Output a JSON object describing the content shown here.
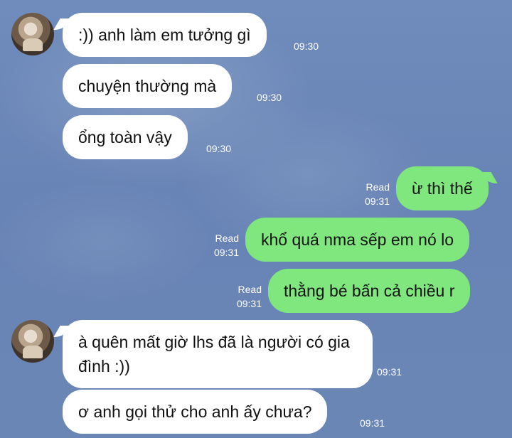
{
  "messages": [
    {
      "direction": "incoming",
      "text": ":)) anh làm em tưởng gì",
      "time": "09:30"
    },
    {
      "direction": "incoming",
      "text": "chuyện thường mà",
      "time": "09:30"
    },
    {
      "direction": "incoming",
      "text": "ổng toàn vậy",
      "time": "09:30"
    },
    {
      "direction": "outgoing",
      "text": "ừ thì thế",
      "status": "Read",
      "time": "09:31"
    },
    {
      "direction": "outgoing",
      "text": "khổ quá nma sếp em nó lo",
      "status": "Read",
      "time": "09:31"
    },
    {
      "direction": "outgoing",
      "text": "thằng bé bấn cả chiều r",
      "status": "Read",
      "time": "09:31"
    },
    {
      "direction": "incoming",
      "text": "à quên mất giờ lhs đã là người có gia đình :))",
      "time": "09:31"
    },
    {
      "direction": "incoming",
      "text": "ơ anh gọi thử cho anh ấy chưa?",
      "time": "09:31"
    }
  ],
  "colors": {
    "incoming_bubble": "#ffffff",
    "outgoing_bubble": "#7fe77d",
    "background": "#6a86b5"
  }
}
